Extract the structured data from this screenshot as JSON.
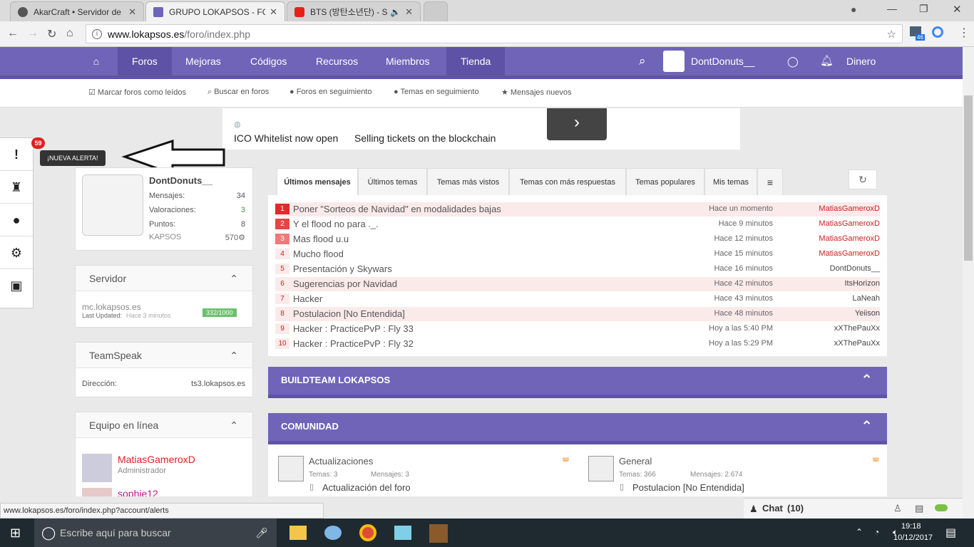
{
  "browser": {
    "tabs": [
      {
        "title": "AkarCraft • Servidor de M",
        "active": false,
        "color": "#555"
      },
      {
        "title": "GRUPO LOKAPSOS - FOR",
        "active": true,
        "color": "#7064b8"
      },
      {
        "title": "BTS (방탄소년단) - Sa",
        "active": false,
        "color": "#e62117"
      }
    ],
    "url_domain": "www.lokapsos.es",
    "url_path": "/foro/index.php",
    "ext_badge": "46"
  },
  "nav": {
    "items": [
      "Foros",
      "Mejoras",
      "Códigos",
      "Recursos",
      "Miembros",
      "Tienda"
    ],
    "user": "DontDonuts__",
    "money": "Dinero"
  },
  "subnav": [
    "Marcar foros como leídos",
    "Buscar en foros",
    "Foros en seguimiento",
    "Temas en seguimiento",
    "Mensajes nuevos"
  ],
  "ad": {
    "text": "ICO Whitelist now open",
    "text2": "Selling tickets on the blockchain"
  },
  "alert": {
    "count": "59",
    "tooltip": "¡NUEVA ALERTA!"
  },
  "profile": {
    "name": "DontDonuts__",
    "stats": [
      {
        "label": "Mensajes:",
        "value": "34"
      },
      {
        "label": "Valoraciones:",
        "value": "3"
      },
      {
        "label": "Puntos:",
        "value": "8"
      },
      {
        "label": "KAPSOS",
        "value": "570⚙"
      }
    ]
  },
  "server": {
    "title": "Servidor",
    "host": "mc.lokapsos.es",
    "updated_label": "Last Updated:",
    "updated_time": "Hace 3 minutos",
    "players": "332/1000"
  },
  "teamspeak": {
    "title": "TeamSpeak",
    "label": "Dirección:",
    "value": "ts3.lokapsos.es"
  },
  "staff": {
    "title": "Equipo en línea",
    "members": [
      {
        "name": "MatiasGameroxD",
        "role": "Administrador"
      },
      {
        "name": "sophie12",
        "role": ""
      }
    ]
  },
  "tabs": [
    "Últimos mensajes",
    "Últimos temas",
    "Temas más vistos",
    "Temas con más respuestas",
    "Temas populares",
    "Mis temas"
  ],
  "messages": [
    {
      "n": "1",
      "title": "Poner \"Sorteos de Navidad\" en modalidades bajas",
      "time": "Hace un momento",
      "user": "MatiasGameroxD",
      "hl": true
    },
    {
      "n": "2",
      "title": "Y el flood no para ._.",
      "time": "Hace 9 minutos",
      "user": "MatiasGameroxD",
      "hl": false
    },
    {
      "n": "3",
      "title": "Mas flood u.u",
      "time": "Hace 12 minutos",
      "user": "MatiasGameroxD",
      "hl": false
    },
    {
      "n": "4",
      "title": "Mucho flood",
      "time": "Hace 15 minutos",
      "user": "MatiasGameroxD",
      "hl": false
    },
    {
      "n": "5",
      "title": "Presentación y Skywars",
      "time": "Hace 16 minutos",
      "user": "DontDonuts__",
      "hl": false
    },
    {
      "n": "6",
      "title": "Sugerencias por Navidad",
      "time": "Hace 42 minutos",
      "user": "ItsHorizon",
      "hl": true
    },
    {
      "n": "7",
      "title": "Hacker",
      "time": "Hace 43 minutos",
      "user": "LaNeah",
      "hl": false
    },
    {
      "n": "8",
      "title": "Postulacion [No Entendida]",
      "time": "Hace 48 minutos",
      "user": "Yeiison",
      "hl": true
    },
    {
      "n": "9",
      "title": "Hacker : PracticePvP : Fly 33",
      "time": "Hoy a las 5:40 PM",
      "user": "xXThePauXx",
      "hl": false
    },
    {
      "n": "10",
      "title": "Hacker : PracticePvP : Fly 32",
      "time": "Hoy a las 5:29 PM",
      "user": "xXThePauXx",
      "hl": false
    }
  ],
  "categories": [
    {
      "title": "BUILDTEAM LOKAPSOS"
    },
    {
      "title": "COMUNIDAD"
    }
  ],
  "forums": [
    {
      "name": "Actualizaciones",
      "temas": "Temas: 3",
      "mensajes": "Mensajes: 3",
      "last": "Actualización del foro"
    },
    {
      "name": "General",
      "temas": "Temas: 366",
      "mensajes": "Mensajes: 2.674",
      "last": "Postulacion [No Entendida]"
    }
  ],
  "status_url": "www.lokapsos.es/foro/index.php?account/alerts",
  "chat": {
    "label": "Chat",
    "count": "(10)"
  },
  "taskbar": {
    "search": "Escribe aquí para buscar",
    "time": "19:18",
    "date": "10/12/2017"
  }
}
